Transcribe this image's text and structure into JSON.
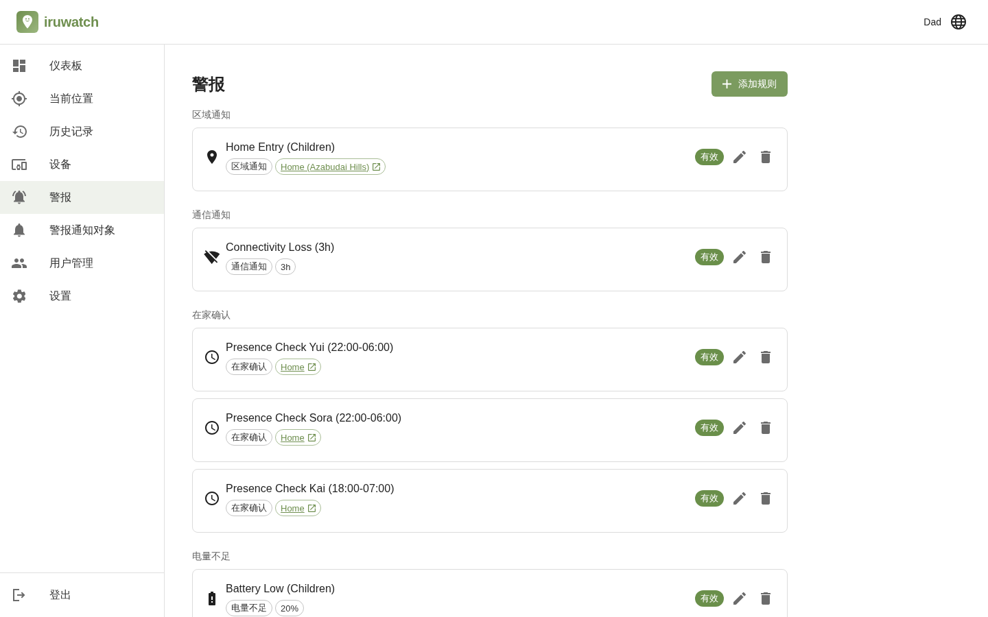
{
  "header": {
    "brand": "iruwatch",
    "user": "Dad"
  },
  "sidebar": {
    "items": [
      {
        "label": "仪表板",
        "selected": false
      },
      {
        "label": "当前位置",
        "selected": false
      },
      {
        "label": "历史记录",
        "selected": false
      },
      {
        "label": "设备",
        "selected": false
      },
      {
        "label": "警报",
        "selected": true
      },
      {
        "label": "警报通知对象",
        "selected": false
      },
      {
        "label": "用户管理",
        "selected": false
      },
      {
        "label": "设置",
        "selected": false
      }
    ],
    "logout": "登出"
  },
  "page": {
    "title": "警报",
    "add_button": "添加规则"
  },
  "sections": [
    {
      "title": "区域通知",
      "rules": [
        {
          "kind": "zone",
          "name": "Home Entry (Children)",
          "tags": [
            {
              "kind": "type",
              "text": "区域通知"
            },
            {
              "kind": "link",
              "text": "Home (Azabudai Hills)"
            }
          ],
          "status": "有效"
        }
      ]
    },
    {
      "title": "通信通知",
      "rules": [
        {
          "kind": "connectivity",
          "name": "Connectivity Loss (3h)",
          "tags": [
            {
              "kind": "type",
              "text": "通信通知"
            },
            {
              "kind": "value",
              "text": "3h"
            }
          ],
          "status": "有效"
        }
      ]
    },
    {
      "title": "在家确认",
      "rules": [
        {
          "kind": "presence",
          "name": "Presence Check Yui (22:00-06:00)",
          "tags": [
            {
              "kind": "type",
              "text": "在家确认"
            },
            {
              "kind": "link",
              "text": "Home"
            }
          ],
          "status": "有效"
        },
        {
          "kind": "presence",
          "name": "Presence Check Sora (22:00-06:00)",
          "tags": [
            {
              "kind": "type",
              "text": "在家确认"
            },
            {
              "kind": "link",
              "text": "Home"
            }
          ],
          "status": "有效"
        },
        {
          "kind": "presence",
          "name": "Presence Check Kai (18:00-07:00)",
          "tags": [
            {
              "kind": "type",
              "text": "在家确认"
            },
            {
              "kind": "link",
              "text": "Home"
            }
          ],
          "status": "有效"
        }
      ]
    },
    {
      "title": "电量不足",
      "rules": [
        {
          "kind": "battery",
          "name": "Battery Low (Children)",
          "tags": [
            {
              "kind": "type",
              "text": "电量不足"
            },
            {
              "kind": "value",
              "text": "20%"
            }
          ],
          "status": "有效"
        }
      ]
    }
  ]
}
